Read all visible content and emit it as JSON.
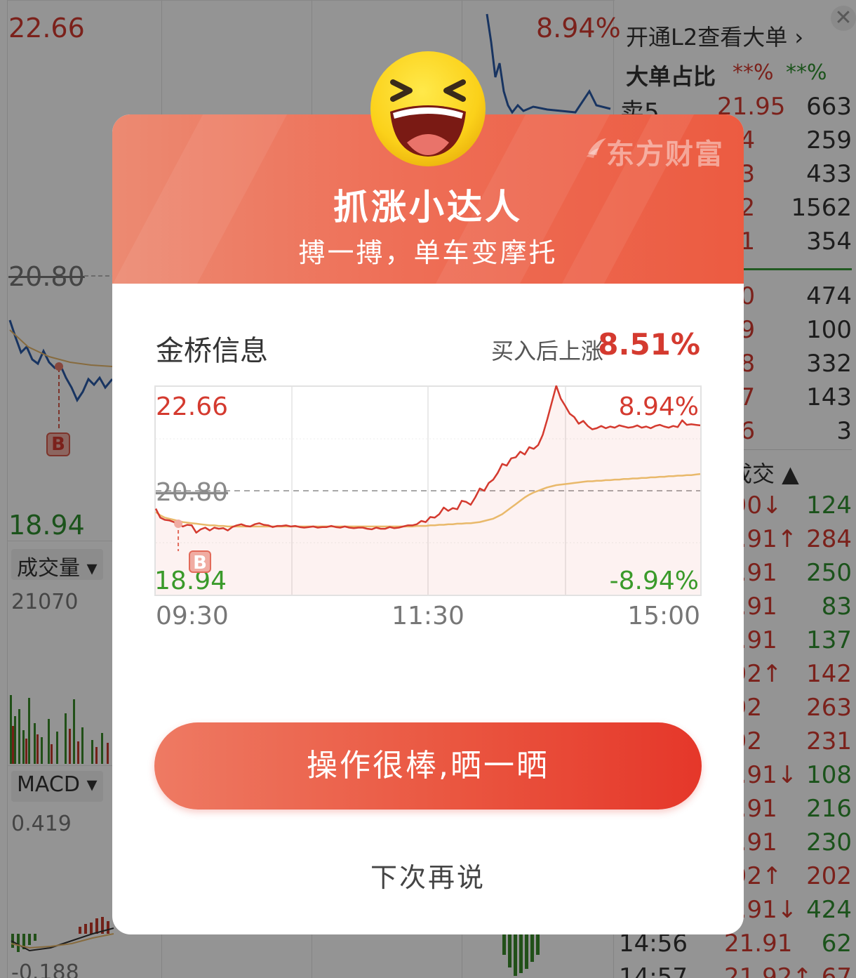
{
  "background": {
    "price_high": "22.66",
    "price_mid": "20.80",
    "price_low": "18.94",
    "pct_high": "8.94%",
    "volume_selector": "成交量 ▾",
    "volume_max": "21070",
    "macd_selector": "MACD ▾",
    "macd_max": "0.419",
    "macd_min": "-0.188",
    "buy_marker": "B",
    "l2_promo": "开通L2查看大单 ›",
    "big_order_label": "大单占比",
    "big_order_buy": "**%",
    "big_order_sell": "**%",
    "close_icon": "close-icon",
    "orderbook": [
      {
        "label": "卖5",
        "price": "21.95",
        "volume": "663"
      },
      {
        "label": "",
        "price": ".94",
        "volume": "259"
      },
      {
        "label": "",
        "price": ".93",
        "volume": "433"
      },
      {
        "label": "",
        "price": ".92",
        "volume": "1562"
      },
      {
        "label": "",
        "price": ".91",
        "volume": "354"
      },
      {
        "label": "",
        "price": ".90",
        "volume": "474"
      },
      {
        "label": "",
        "price": ".89",
        "volume": "100"
      },
      {
        "label": "",
        "price": ".88",
        "volume": "332"
      },
      {
        "label": "",
        "price": ".87",
        "volume": "143"
      },
      {
        "label": "",
        "price": ".86",
        "volume": "3"
      }
    ],
    "trades_header": "成交 ▲",
    "trades": [
      {
        "time": "",
        "price": ".90↓",
        "volume": "124",
        "dir": "green"
      },
      {
        "time": "",
        "price": "1.91↑",
        "volume": "284",
        "dir": "red"
      },
      {
        "time": "",
        "price": "1.91",
        "volume": "250",
        "dir": "green"
      },
      {
        "time": "",
        "price": "1.91",
        "volume": "83",
        "dir": "green"
      },
      {
        "time": "",
        "price": "1.91",
        "volume": "137",
        "dir": "green"
      },
      {
        "time": "",
        "price": ".92↑",
        "volume": "142",
        "dir": "red"
      },
      {
        "time": "",
        "price": ".92",
        "volume": "263",
        "dir": "red"
      },
      {
        "time": "",
        "price": ".92",
        "volume": "231",
        "dir": "red"
      },
      {
        "time": "",
        "price": "1.91↓",
        "volume": "108",
        "dir": "green"
      },
      {
        "time": "",
        "price": "1.91",
        "volume": "216",
        "dir": "green"
      },
      {
        "time": "",
        "price": "1.91",
        "volume": "230",
        "dir": "green"
      },
      {
        "time": "",
        "price": ".92↑",
        "volume": "202",
        "dir": "red"
      },
      {
        "time": "",
        "price": "1.91↓",
        "volume": "424",
        "dir": "green"
      },
      {
        "time": "14:56",
        "price": "21.91",
        "volume": "62",
        "dir": "green"
      },
      {
        "time": "14:57",
        "price": "21.92↑",
        "volume": "67",
        "dir": "red"
      }
    ]
  },
  "dialog": {
    "brand": "东方财富",
    "title": "抓涨小达人",
    "subtitle": "搏一搏，单车变摩托",
    "stock_name": "金桥信息",
    "gain_label": "买入后上涨",
    "gain_value": "8.51%",
    "cta_label": "操作很棒,晒一晒",
    "later_label": "下次再说",
    "colors": {
      "accent": "#e5372a",
      "up": "#d43a2f",
      "down": "#2f9a2f",
      "avg": "#e9b96b"
    }
  },
  "chart_data": {
    "type": "line",
    "price_top_label": "22.66",
    "price_ref_label": "20.80",
    "price_bottom_label": "18.94",
    "pct_top_label": "8.94%",
    "pct_bottom_label": "-8.94%",
    "x_ticks": [
      "09:30",
      "11:30",
      "15:00"
    ],
    "ylim": [
      18.94,
      22.66
    ],
    "reference": 20.8,
    "buy_marker_label": "B",
    "buy_marker_index": 5,
    "series": [
      {
        "values": [
          20.48,
          20.32,
          20.28,
          20.27,
          20.24,
          20.21,
          20.16,
          20.19,
          20.18,
          20.05,
          20.11,
          20.14,
          20.09,
          20.14,
          20.12,
          20.13,
          20.09,
          20.15,
          20.18,
          20.2,
          20.17,
          20.16,
          20.2,
          20.22,
          20.19,
          20.18,
          20.15,
          20.17,
          20.17,
          20.18,
          20.16,
          20.17,
          20.15,
          20.14,
          20.15,
          20.16,
          20.14,
          20.15,
          20.15,
          20.17,
          20.15,
          20.14,
          20.16,
          20.14,
          20.13,
          20.14,
          20.14,
          20.12,
          20.11,
          20.14,
          20.12,
          20.12,
          20.15,
          20.13,
          20.14,
          20.16,
          20.18,
          20.18,
          20.2,
          20.26,
          20.24,
          20.33,
          20.32,
          20.38,
          20.5,
          20.44,
          20.49,
          20.47,
          20.62,
          20.6,
          20.55,
          20.68,
          20.84,
          20.8,
          20.94,
          21.0,
          21.12,
          21.28,
          21.25,
          21.38,
          21.4,
          21.5,
          21.45,
          21.58,
          21.55,
          21.62,
          21.8,
          22.08,
          22.38,
          22.68,
          22.45,
          22.32,
          22.18,
          22.12,
          22.0,
          22.05,
          21.96,
          21.9,
          21.92,
          21.96,
          21.92,
          21.95,
          21.93,
          21.97,
          21.95,
          21.93,
          21.94,
          21.97,
          21.93,
          21.95,
          21.92,
          21.96,
          21.98,
          21.95,
          21.93,
          21.96,
          21.94,
          22.06,
          21.98,
          21.99,
          21.98,
          21.97
        ]
      },
      {
        "values": [
          20.42,
          20.36,
          20.32,
          20.3,
          20.28,
          20.26,
          20.24,
          20.23,
          20.22,
          20.21,
          20.2,
          20.19,
          20.18,
          20.18,
          20.17,
          20.17,
          20.16,
          20.16,
          20.16,
          20.16,
          20.16,
          20.16,
          20.16,
          20.16,
          20.16,
          20.16,
          20.16,
          20.16,
          20.16,
          20.16,
          20.16,
          20.16,
          20.16,
          20.16,
          20.16,
          20.16,
          20.16,
          20.16,
          20.16,
          20.16,
          20.16,
          20.16,
          20.16,
          20.16,
          20.16,
          20.16,
          20.16,
          20.16,
          20.16,
          20.16,
          20.16,
          20.16,
          20.16,
          20.16,
          20.16,
          20.16,
          20.16,
          20.16,
          20.17,
          20.17,
          20.17,
          20.18,
          20.18,
          20.19,
          20.19,
          20.2,
          20.2,
          20.21,
          20.21,
          20.22,
          20.22,
          20.23,
          20.24,
          20.26,
          20.28,
          20.3,
          20.34,
          20.38,
          20.44,
          20.5,
          20.56,
          20.62,
          20.68,
          20.73,
          20.77,
          20.8,
          20.83,
          20.86,
          20.88,
          20.9,
          20.91,
          20.92,
          20.93,
          20.94,
          20.95,
          20.96,
          20.97,
          20.97,
          20.98,
          20.98,
          20.99,
          20.99,
          21.0,
          21.0,
          21.01,
          21.01,
          21.02,
          21.02,
          21.03,
          21.03,
          21.04,
          21.04,
          21.05,
          21.05,
          21.06,
          21.06,
          21.07,
          21.07,
          21.08,
          21.08,
          21.09,
          21.1
        ]
      }
    ]
  }
}
